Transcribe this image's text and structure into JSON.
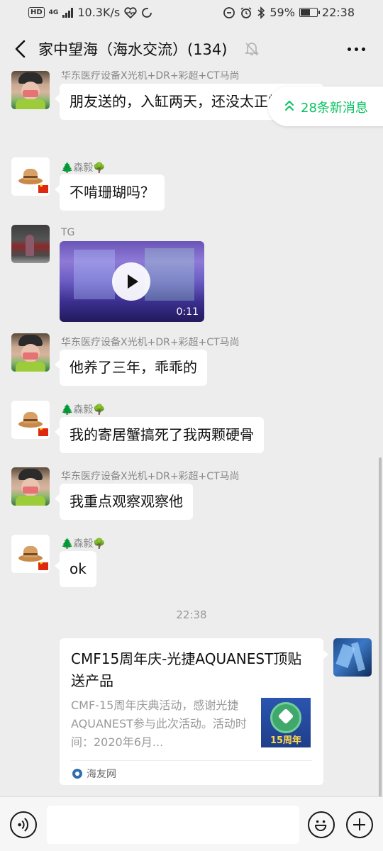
{
  "status_bar": {
    "hd_badge": "HD",
    "network_type": "4G",
    "net_speed": "10.3K/s",
    "battery_percent": "59%",
    "time": "22:38"
  },
  "header": {
    "title": "家中望海（海水交流）(134)"
  },
  "new_messages_pill": {
    "label": "28条新消息"
  },
  "messages": [
    {
      "sender": "华东医疗设备X光机+DR+彩超+CT马尚",
      "text": "朋友送的，入缸两天，还没太正常"
    },
    {
      "sender": "🌲森毅🌳",
      "text": "不啃珊瑚吗？"
    },
    {
      "sender": "TG",
      "video_duration": "0:11"
    },
    {
      "sender": "华东医疗设备X光机+DR+彩超+CT马尚",
      "text": "他养了三年，乖乖的"
    },
    {
      "sender": "🌲森毅🌳",
      "text": "我的寄居蟹搞死了我两颗硬骨"
    },
    {
      "sender": "华东医疗设备X光机+DR+彩超+CT马尚",
      "text": "我重点观察观察他"
    },
    {
      "sender": "🌲森毅🌳",
      "text": "ok"
    }
  ],
  "timestamp": "22:38",
  "link_card": {
    "title": "CMF15周年庆-光捷AQUANEST顶贴送产品",
    "description": "CMF-15周年庆典活动，感谢光捷AQUANEST参与此次活动。活动时间：2020年6月...",
    "thumb_badge": "15周年",
    "source": "海友网"
  },
  "colors": {
    "accent_green": "#07c160",
    "background": "#ededed",
    "bubble": "#ffffff"
  },
  "icons": [
    "back-arrow-icon",
    "mute-bell-icon",
    "more-dots-icon",
    "double-chevron-up-icon",
    "play-icon",
    "voice-icon",
    "emoji-icon",
    "plus-icon"
  ]
}
